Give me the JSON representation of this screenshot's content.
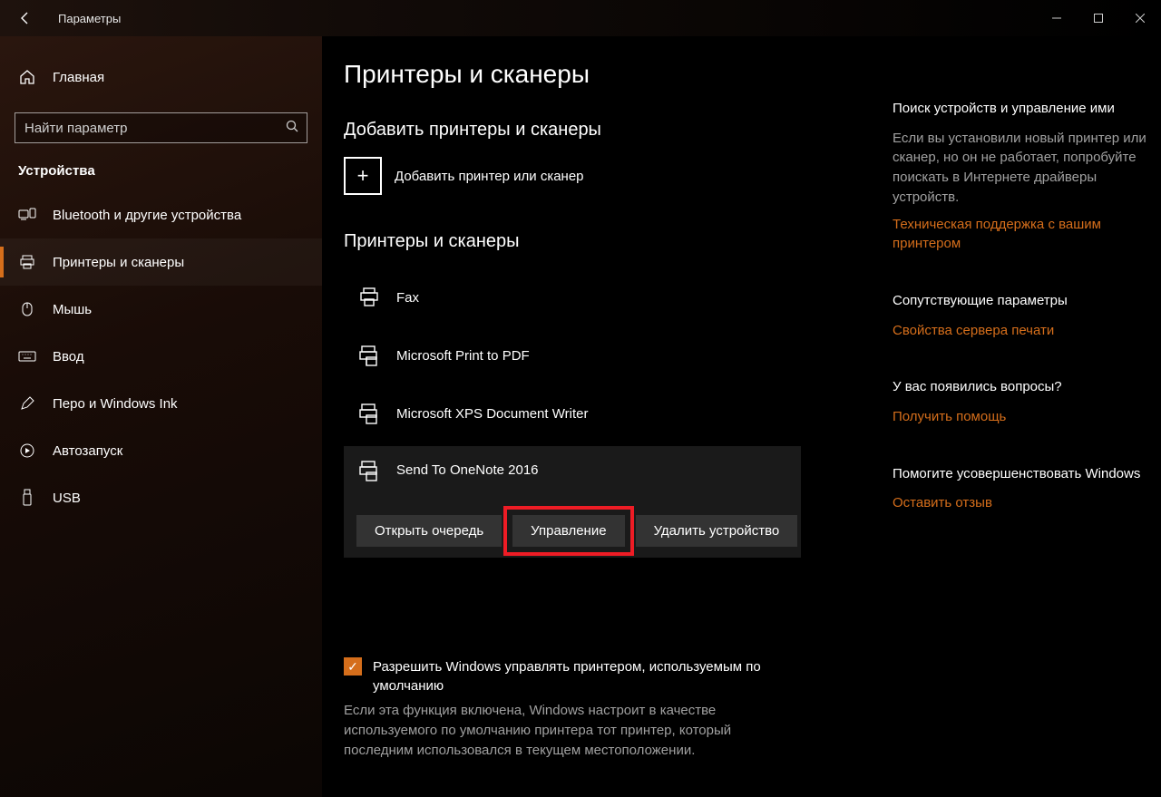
{
  "window": {
    "title": "Параметры"
  },
  "sidebar": {
    "home": "Главная",
    "search_placeholder": "Найти параметр",
    "section": "Устройства",
    "items": [
      {
        "label": "Bluetooth и другие устройства"
      },
      {
        "label": "Принтеры и сканеры"
      },
      {
        "label": "Мышь"
      },
      {
        "label": "Ввод"
      },
      {
        "label": "Перо и Windows Ink"
      },
      {
        "label": "Автозапуск"
      },
      {
        "label": "USB"
      }
    ]
  },
  "main": {
    "title": "Принтеры и сканеры",
    "add_section": "Добавить принтеры и сканеры",
    "add_label": "Добавить принтер или сканер",
    "list_section": "Принтеры и сканеры",
    "devices": [
      {
        "label": "Fax"
      },
      {
        "label": "Microsoft Print to PDF"
      },
      {
        "label": "Microsoft XPS Document Writer"
      },
      {
        "label": "Send To OneNote 2016"
      }
    ],
    "buttons": {
      "queue": "Открыть очередь",
      "manage": "Управление",
      "remove": "Удалить устройство"
    },
    "checkbox": {
      "label": "Разрешить Windows управлять принтером, используемым по умолчанию",
      "desc": "Если эта функция включена, Windows настроит в качестве используемого по умолчанию принтера тот принтер, который последним использовался в текущем местоположении."
    }
  },
  "right": {
    "block1_heading": "Поиск устройств и управление ими",
    "block1_text": "Если вы установили новый принтер или сканер, но он не работает, попробуйте поискать в Интернете драйверы устройств.",
    "block1_link": "Техническая поддержка с вашим принтером",
    "block2_heading": "Сопутствующие параметры",
    "block2_link": "Свойства сервера печати",
    "block3_heading": "У вас появились вопросы?",
    "block3_link": "Получить помощь",
    "block4_heading": "Помогите усовершенствовать Windows",
    "block4_link": "Оставить отзыв"
  }
}
